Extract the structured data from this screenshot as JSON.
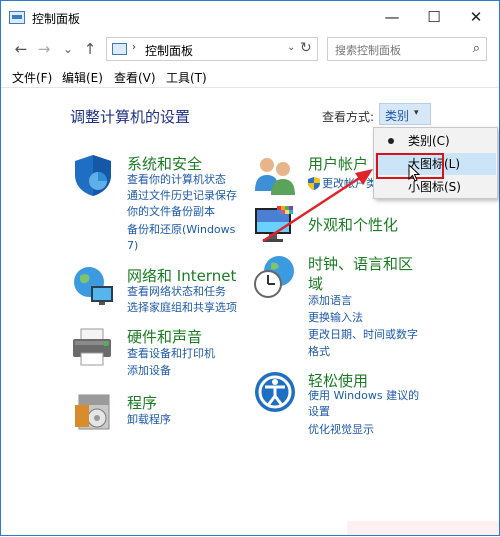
{
  "window": {
    "title": "控制面板",
    "minimize": "—",
    "maximize": "☐",
    "close": "✕"
  },
  "nav": {
    "back": "←",
    "forward": "→",
    "recent": "⌄",
    "up": "↑"
  },
  "address": {
    "separator": "›",
    "path": "控制面板",
    "dropdown": "⌄",
    "refresh": "↻"
  },
  "search": {
    "placeholder": "搜索控制面板",
    "icon": "⌕"
  },
  "menu": {
    "items": [
      "文件(F)",
      "编辑(E)",
      "查看(V)",
      "工具(T)"
    ]
  },
  "content": {
    "heading": "调整计算机的设置",
    "view_by_label": "查看方式:",
    "view_by_value": "类别",
    "view_by_arrow": "▾"
  },
  "categories": [
    {
      "title": "系统和安全",
      "links": [
        "查看你的计算机状态",
        "通过文件历史记录保存",
        "你的文件备份副本",
        "备份和还原(Windows",
        "7)"
      ]
    },
    {
      "title": "网络和 Internet",
      "links": [
        "查看网络状态和任务",
        "选择家庭组和共享选项"
      ]
    },
    {
      "title": "硬件和声音",
      "links": [
        "查看设备和打印机",
        "添加设备"
      ]
    },
    {
      "title": "程序",
      "links": [
        "卸载程序"
      ]
    },
    {
      "title": "用户帐户",
      "links": [
        "更改帐户类"
      ]
    },
    {
      "title": "外观和个性化",
      "links": []
    },
    {
      "title": "时钟、语言和区",
      "title2": "域",
      "links": [
        "添加语言",
        "更换输入法",
        "更改日期、时间或数字",
        "格式"
      ]
    },
    {
      "title": "轻松使用",
      "links": [
        "使用 Windows 建议的",
        "设置",
        "优化视觉显示"
      ]
    }
  ],
  "dropdown": {
    "items": [
      "类别(C)",
      "大图标(L)",
      "小图标(S)"
    ],
    "selected_index": 0,
    "highlighted_index": 1
  },
  "colors": {
    "accent": "#1e5aa8",
    "category_title": "#1c7c25",
    "heading": "#1e3287",
    "highlight_box": "#d4141b"
  }
}
